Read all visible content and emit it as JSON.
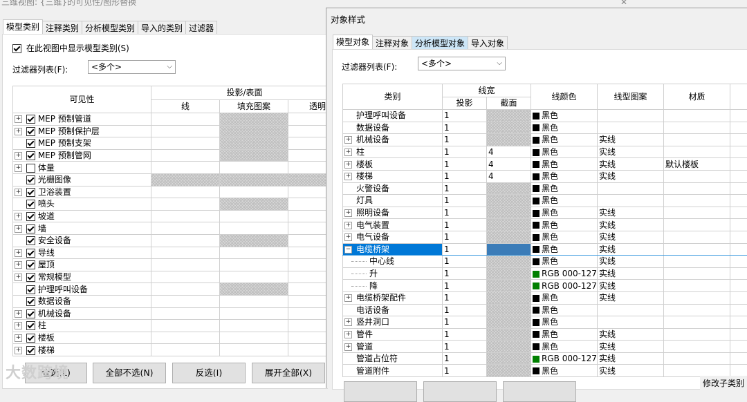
{
  "back_dialog": {
    "title": "三维视图: {三维}的可见性/图形替换",
    "close_label": "✕",
    "tabs": [
      "模型类别",
      "注释类别",
      "分析模型类别",
      "导入的类别",
      "过滤器"
    ],
    "show_checkbox_label": "在此视图中显示模型类别(S)",
    "filter_label": "过滤器列表(F):",
    "filter_value": "<多个>",
    "headers": {
      "visibility": "可见性",
      "projection": "投影/表面",
      "line": "线",
      "fill": "填充图案",
      "transparency": "透明"
    },
    "rows": [
      {
        "name": "MEP 预制管道",
        "expand": true,
        "checked": true
      },
      {
        "name": "MEP 预制保护层",
        "expand": true,
        "checked": true
      },
      {
        "name": "MEP 预制支架",
        "expand": false,
        "checked": true
      },
      {
        "name": "MEP 预制管网",
        "expand": true,
        "checked": true
      },
      {
        "name": "体量",
        "expand": true,
        "checked": false
      },
      {
        "name": "光栅图像",
        "expand": false,
        "checked": true
      },
      {
        "name": "卫浴装置",
        "expand": true,
        "checked": true
      },
      {
        "name": "喷头",
        "expand": false,
        "checked": true
      },
      {
        "name": "坡道",
        "expand": true,
        "checked": true
      },
      {
        "name": "墙",
        "expand": true,
        "checked": true
      },
      {
        "name": "安全设备",
        "expand": false,
        "checked": true
      },
      {
        "name": "导线",
        "expand": true,
        "checked": true
      },
      {
        "name": "屋顶",
        "expand": true,
        "checked": true
      },
      {
        "name": "常规模型",
        "expand": true,
        "checked": true
      },
      {
        "name": "护理呼叫设备",
        "expand": false,
        "checked": true
      },
      {
        "name": "数据设备",
        "expand": false,
        "checked": true
      },
      {
        "name": "机械设备",
        "expand": true,
        "checked": true
      },
      {
        "name": "柱",
        "expand": true,
        "checked": true
      },
      {
        "name": "楼板",
        "expand": true,
        "checked": true
      },
      {
        "name": "楼梯",
        "expand": true,
        "checked": true
      }
    ],
    "buttons": [
      "全选(L)",
      "全部不选(N)",
      "反选(I)",
      "展开全部(X)"
    ]
  },
  "front_dialog": {
    "title": "对象样式",
    "tabs": [
      "模型对象",
      "注释对象",
      "分析模型对象",
      "导入对象"
    ],
    "filter_label": "过滤器列表(F):",
    "filter_value": "<多个>",
    "headers": {
      "category": "类别",
      "lineweight": "线宽",
      "projection": "投影",
      "cut": "截面",
      "line_color": "线颜色",
      "line_pattern": "线型图案",
      "material": "材质"
    },
    "rows": [
      {
        "name": "护理呼叫设备",
        "kind": "leaf",
        "proj": "1",
        "cut": "",
        "color": "黑色",
        "swatch": "#000000",
        "pattern": "",
        "material": ""
      },
      {
        "name": "数据设备",
        "kind": "leaf",
        "proj": "1",
        "cut": "",
        "color": "黑色",
        "swatch": "#000000",
        "pattern": "",
        "material": ""
      },
      {
        "name": "机械设备",
        "kind": "expand",
        "proj": "1",
        "cut": "",
        "color": "黑色",
        "swatch": "#000000",
        "pattern": "实线",
        "material": ""
      },
      {
        "name": "柱",
        "kind": "expand",
        "proj": "1",
        "cut": "4",
        "color": "黑色",
        "swatch": "#000000",
        "pattern": "实线",
        "material": ""
      },
      {
        "name": "楼板",
        "kind": "expand",
        "proj": "1",
        "cut": "4",
        "color": "黑色",
        "swatch": "#000000",
        "pattern": "实线",
        "material": "默认楼板"
      },
      {
        "name": "楼梯",
        "kind": "expand",
        "proj": "1",
        "cut": "4",
        "color": "黑色",
        "swatch": "#000000",
        "pattern": "实线",
        "material": ""
      },
      {
        "name": "火警设备",
        "kind": "leaf",
        "proj": "1",
        "cut": "",
        "color": "黑色",
        "swatch": "#000000",
        "pattern": "",
        "material": ""
      },
      {
        "name": "灯具",
        "kind": "leaf",
        "proj": "1",
        "cut": "",
        "color": "黑色",
        "swatch": "#000000",
        "pattern": "",
        "material": ""
      },
      {
        "name": "照明设备",
        "kind": "expand",
        "proj": "1",
        "cut": "",
        "color": "黑色",
        "swatch": "#000000",
        "pattern": "实线",
        "material": ""
      },
      {
        "name": "电气装置",
        "kind": "expand",
        "proj": "1",
        "cut": "",
        "color": "黑色",
        "swatch": "#000000",
        "pattern": "实线",
        "material": ""
      },
      {
        "name": "电气设备",
        "kind": "expand",
        "proj": "1",
        "cut": "",
        "color": "黑色",
        "swatch": "#000000",
        "pattern": "实线",
        "material": ""
      },
      {
        "name": "电缆桥架",
        "kind": "collapse",
        "proj": "1",
        "cut": "",
        "color": "黑色",
        "swatch": "#000000",
        "pattern": "实线",
        "material": "",
        "selected": true
      },
      {
        "name": "中心线",
        "kind": "child",
        "proj": "1",
        "cut": "",
        "color": "黑色",
        "swatch": "#000000",
        "pattern": "实线",
        "material": ""
      },
      {
        "name": "升",
        "kind": "child",
        "proj": "1",
        "cut": "",
        "color": "RGB 000-127-",
        "swatch": "#008000",
        "pattern": "实线",
        "material": ""
      },
      {
        "name": "降",
        "kind": "child",
        "proj": "1",
        "cut": "",
        "color": "RGB 000-127-",
        "swatch": "#008000",
        "pattern": "实线",
        "material": ""
      },
      {
        "name": "电缆桥架配件",
        "kind": "expand",
        "proj": "1",
        "cut": "",
        "color": "黑色",
        "swatch": "#000000",
        "pattern": "实线",
        "material": ""
      },
      {
        "name": "电话设备",
        "kind": "leaf",
        "proj": "1",
        "cut": "",
        "color": "黑色",
        "swatch": "#000000",
        "pattern": "",
        "material": ""
      },
      {
        "name": "竖井洞口",
        "kind": "expand",
        "proj": "1",
        "cut": "",
        "color": "黑色",
        "swatch": "#000000",
        "pattern": "",
        "material": ""
      },
      {
        "name": "管件",
        "kind": "expand",
        "proj": "1",
        "cut": "",
        "color": "黑色",
        "swatch": "#000000",
        "pattern": "实线",
        "material": ""
      },
      {
        "name": "管道",
        "kind": "expand",
        "proj": "1",
        "cut": "",
        "color": "黑色",
        "swatch": "#000000",
        "pattern": "实线",
        "material": ""
      },
      {
        "name": "管道占位符",
        "kind": "leaf",
        "proj": "1",
        "cut": "",
        "color": "RGB 000-127-",
        "swatch": "#008000",
        "pattern": "实线",
        "material": ""
      },
      {
        "name": "管道附件",
        "kind": "leaf",
        "proj": "1",
        "cut": "",
        "color": "黑色",
        "swatch": "#000000",
        "pattern": "实线",
        "material": ""
      }
    ],
    "modify_sub_label": "修改子类别"
  },
  "watermark": "大数跨境"
}
